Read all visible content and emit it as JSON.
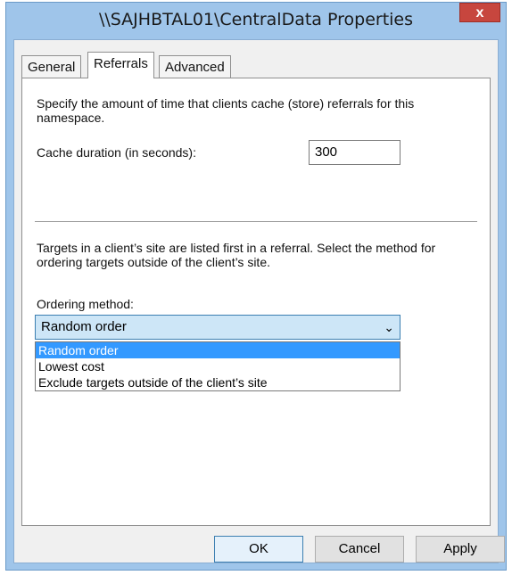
{
  "window": {
    "title": "\\\\SAJHBTAL01\\CentralData Properties",
    "close_label": "x"
  },
  "tabs": [
    {
      "label": "General",
      "active": false
    },
    {
      "label": "Referrals",
      "active": true
    },
    {
      "label": "Advanced",
      "active": false
    }
  ],
  "referrals": {
    "intro": "Specify the amount of time that clients cache (store) referrals for this namespace.",
    "cache_label": "Cache duration (in seconds):",
    "cache_value": "300",
    "targets_text": "Targets in a client’s site are listed first in a referral. Select the method for ordering targets outside of the client’s site.",
    "ordering_label": "Ordering method:",
    "ordering_selected": "Random order",
    "ordering_options": [
      "Random order",
      "Lowest cost",
      "Exclude targets outside of the client’s site"
    ]
  },
  "buttons": {
    "ok": "OK",
    "cancel": "Cancel",
    "apply": "Apply"
  }
}
